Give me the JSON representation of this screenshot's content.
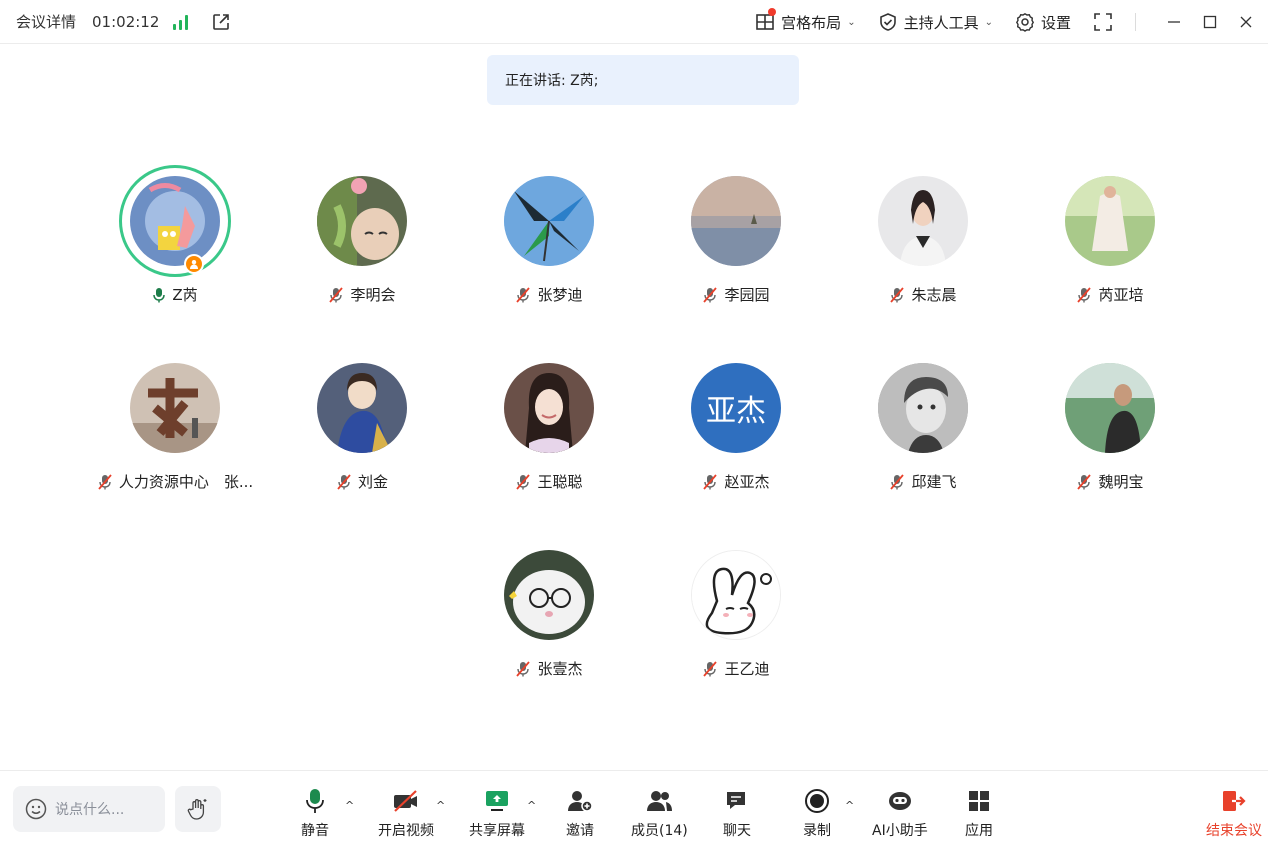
{
  "topbar": {
    "title": "会议详情",
    "timer": "01:02:12",
    "layout_label": "宫格布局",
    "host_tools_label": "主持人工具",
    "settings_label": "设置"
  },
  "speaking": {
    "text": "正在讲话: Z芮;"
  },
  "participants": [
    {
      "name": "Z芮",
      "mic": "on",
      "host": true,
      "speaking": true
    },
    {
      "name": "李明会",
      "mic": "muted"
    },
    {
      "name": "张梦迪",
      "mic": "muted"
    },
    {
      "name": "李园园",
      "mic": "muted"
    },
    {
      "name": "朱志晨",
      "mic": "muted"
    },
    {
      "name": "芮亚培",
      "mic": "muted"
    },
    {
      "name": "人力资源中心　张...",
      "mic": "muted"
    },
    {
      "name": "刘金",
      "mic": "muted"
    },
    {
      "name": "王聪聪",
      "mic": "muted"
    },
    {
      "name": "赵亚杰",
      "mic": "muted",
      "avatar_text": "亚杰",
      "avatar_color": "#2f6fbf"
    },
    {
      "name": "邱建飞",
      "mic": "muted"
    },
    {
      "name": "魏明宝",
      "mic": "muted"
    },
    {
      "name": "张壹杰",
      "mic": "muted"
    },
    {
      "name": "王乙迪",
      "mic": "muted"
    }
  ],
  "toolbar": {
    "chat_placeholder": "说点什么...",
    "mute_label": "静音",
    "video_label": "开启视频",
    "share_label": "共享屏幕",
    "invite_label": "邀请",
    "members_label": "成员(14)",
    "chat_label": "聊天",
    "record_label": "录制",
    "ai_label": "AI小助手",
    "apps_label": "应用",
    "end_label": "结束会议"
  },
  "colors": {
    "accent_green": "#22b45a",
    "speaking_ring": "#3ac889",
    "end_red": "#e8412b",
    "banner_bg": "#e9f1fd"
  }
}
